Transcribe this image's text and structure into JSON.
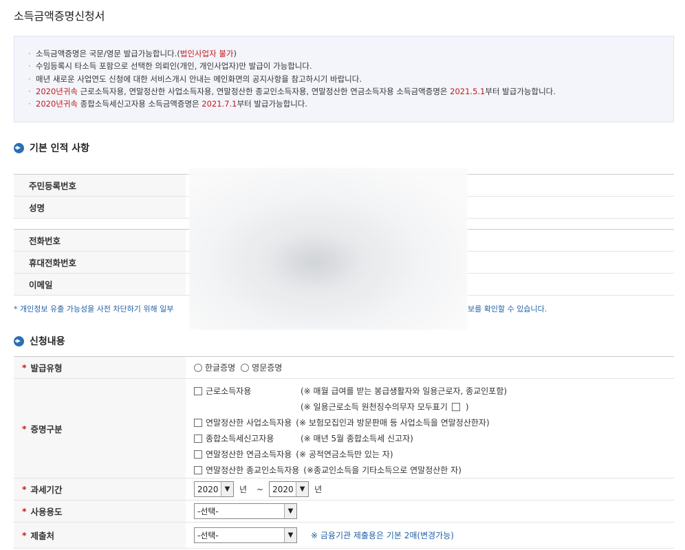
{
  "page": {
    "title": "소득금액증명신청서"
  },
  "notice": {
    "lines": [
      {
        "pre": "소득금액증명은 국문/영문 발급가능합니다.(",
        "red": "법인사업자 불가",
        "post": ")"
      },
      {
        "pre": "수임등록시 타소득 포함으로 선택한 의뢰인(개인, 개인사업자)만 발급이 가능합니다.",
        "red": "",
        "post": ""
      },
      {
        "pre": "매년 새로운 사업연도 신청에 대한 서비스개시 안내는 메인화면의 공지사항을 참고하시기 바랍니다.",
        "red": "",
        "post": ""
      }
    ],
    "line4": {
      "red1": "2020년귀속",
      "mid": " 근로소득자용, 연말정산한 사업소득자용, 연말정산한 종교인소득자용, 연말정산한 연금소득자용 소득금액증명은 ",
      "red2": "2021.5.1",
      "post": "부터 발급가능합니다."
    },
    "line5": {
      "red1": "2020년귀속",
      "mid": " 종합소득세신고자용 소득금액증명은 ",
      "red2": "2021.7.1",
      "post": "부터 발급가능합니다."
    }
  },
  "basic": {
    "title": "기본 인적 사항",
    "rows1": [
      {
        "label": "주민등록번호"
      },
      {
        "label": "성명"
      }
    ],
    "rows2": [
      {
        "label": "전화번호"
      },
      {
        "label": "휴대전화번호"
      },
      {
        "label": "이메일"
      }
    ],
    "note_head": "* 개인정보 유출 가능성을 사전 차단하기 위해 일부",
    "note_tail": "보를 확인할 수 있습니다."
  },
  "apply": {
    "title": "신청내용",
    "issue_type": {
      "label": "발급유형",
      "options": [
        "한글증명",
        "영문증명"
      ]
    },
    "cert_type": {
      "label": "증명구분",
      "items": [
        {
          "label": "근로소득자용",
          "note": "(※ 매월 급여를 받는 봉급생활자와 일용근로자, 종교인포함)"
        },
        {
          "label": "",
          "note": "(※ 일용근로소득 원천징수의무자 모두표기",
          "note_tail": ")"
        },
        {
          "label": "연말정산한 사업소득자용",
          "note": "(※ 보험모집인과 방문판매 등 사업소득을 연말정산한자)"
        },
        {
          "label": "종합소득세신고자용",
          "note": "(※ 매년 5월 종합소득세 신고자)"
        },
        {
          "label": "연말정산한 연금소득자용",
          "note": "(※ 공적연금소득만 있는 자)"
        },
        {
          "label": "연말정산한 종교인소득자용",
          "note": "(※종교인소득을 기타소득으로 연말정산한 자)"
        }
      ]
    },
    "period": {
      "label": "과세기간",
      "from": "2020",
      "to": "2020",
      "unit": "년",
      "tilde": "~"
    },
    "usage": {
      "label": "사용용도",
      "value": "-선택-"
    },
    "submit_to": {
      "label": "제출처",
      "value": "-선택-",
      "hint": "※ 금융기관 제출용은 기본 2매(변경가능)"
    },
    "required_mark": "*"
  }
}
